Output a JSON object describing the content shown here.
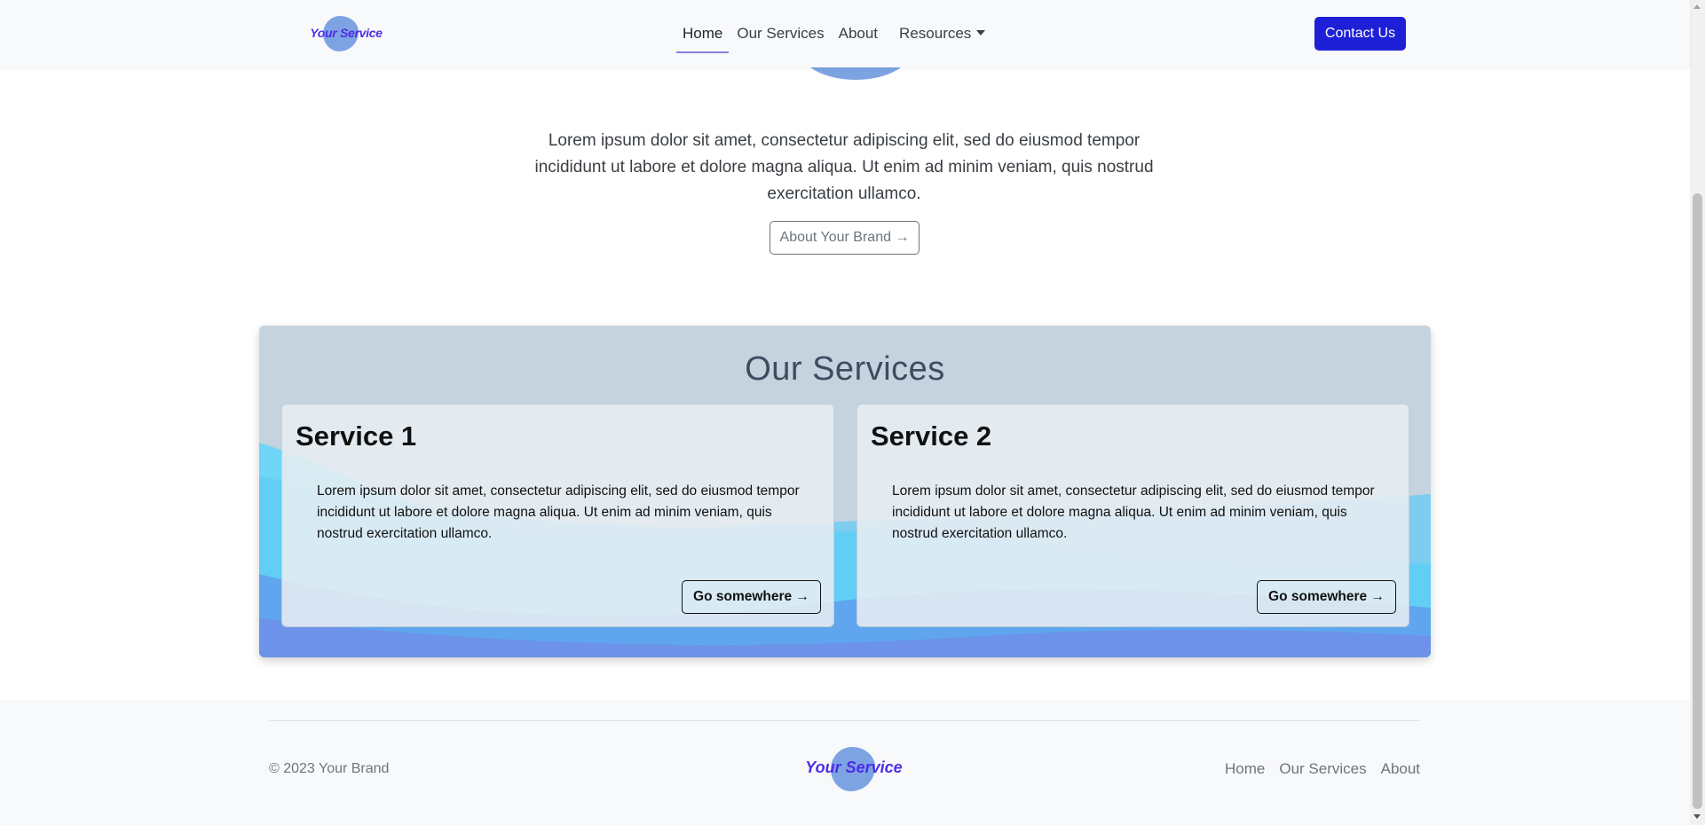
{
  "navbar": {
    "brand": "Your Service",
    "links": [
      {
        "label": "Home"
      },
      {
        "label": "Our Services"
      },
      {
        "label": "About"
      },
      {
        "label": "Resources"
      }
    ],
    "contact_label": "Contact Us"
  },
  "hero": {
    "text": "Lorem ipsum dolor sit amet, consectetur adipiscing elit, sed do eiusmod tempor incididunt ut labore et dolore magna aliqua. Ut enim ad minim veniam, quis nostrud exercitation ullamco.",
    "button_label": "About Your Brand"
  },
  "services": {
    "title": "Our Services",
    "cards": [
      {
        "title": "Service 1",
        "text": "Lorem ipsum dolor sit amet, consectetur adipiscing elit, sed do eiusmod tempor incididunt ut labore et dolore magna aliqua. Ut enim ad minim veniam, quis nostrud exercitation ullamco.",
        "button_label": "Go somewhere"
      },
      {
        "title": "Service 2",
        "text": "Lorem ipsum dolor sit amet, consectetur adipiscing elit, sed do eiusmod tempor incididunt ut labore et dolore magna aliqua. Ut enim ad minim veniam, quis nostrud exercitation ullamco.",
        "button_label": "Go somewhere"
      }
    ]
  },
  "footer": {
    "copyright": "© 2023 Your Brand",
    "brand": "Your Service",
    "links": [
      {
        "label": "Home"
      },
      {
        "label": "Our Services"
      },
      {
        "label": "About"
      }
    ]
  },
  "colors": {
    "accent": "#1d20d6",
    "brand_text": "#4b2ee6",
    "blob": "#7ea3e3",
    "services_bg": "#c5d3df"
  },
  "icons": {
    "arrow": "arrow-right-icon",
    "caret": "caret-down-icon"
  }
}
